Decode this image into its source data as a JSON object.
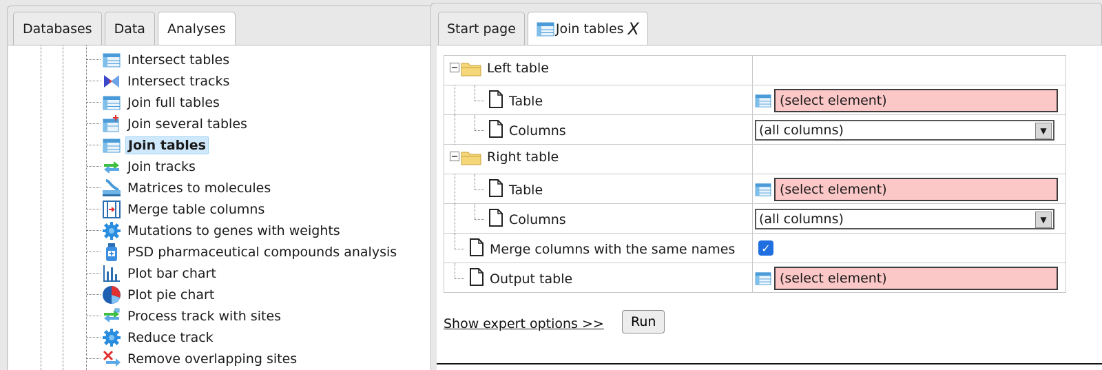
{
  "left_tabs": [
    "Databases",
    "Data",
    "Analyses"
  ],
  "tree_items": [
    {
      "label": "Intersect tables",
      "icon": "table-icon"
    },
    {
      "label": "Intersect tracks",
      "icon": "intersect-tracks-icon"
    },
    {
      "label": "Join full tables",
      "icon": "table-icon"
    },
    {
      "label": "Join several tables",
      "icon": "table-add-icon"
    },
    {
      "label": "Join tables",
      "icon": "table-icon"
    },
    {
      "label": "Join tracks",
      "icon": "join-tracks-icon"
    },
    {
      "label": "Matrices to molecules",
      "icon": "matrices-icon"
    },
    {
      "label": "Merge table columns",
      "icon": "merge-columns-icon"
    },
    {
      "label": "Mutations to genes with weights",
      "icon": "gear-icon"
    },
    {
      "label": "PSD pharmaceutical compounds analysis",
      "icon": "bottle-icon"
    },
    {
      "label": "Plot bar chart",
      "icon": "bar-chart-icon"
    },
    {
      "label": "Plot pie chart",
      "icon": "pie-chart-icon"
    },
    {
      "label": "Process track with sites",
      "icon": "process-track-icon"
    },
    {
      "label": "Reduce track",
      "icon": "gear-icon"
    },
    {
      "label": "Remove overlapping sites",
      "icon": "remove-sites-icon"
    }
  ],
  "right_tabs": {
    "start": "Start page",
    "join": "Join tables",
    "close": "X"
  },
  "form": {
    "left_table": "Left table",
    "table": "Table",
    "columns": "Columns",
    "right_table": "Right table",
    "merge": "Merge columns with the same names",
    "output": "Output table",
    "select_placeholder": "(select element)",
    "columns_value": "(all columns)",
    "merge_checked": true
  },
  "actions": {
    "expert": "Show expert options >>",
    "run": "Run"
  },
  "colors": {
    "select_bg": "#fcc7c7",
    "selection_bg": "#cfe8fb",
    "checkbox": "#1f6fe0"
  }
}
